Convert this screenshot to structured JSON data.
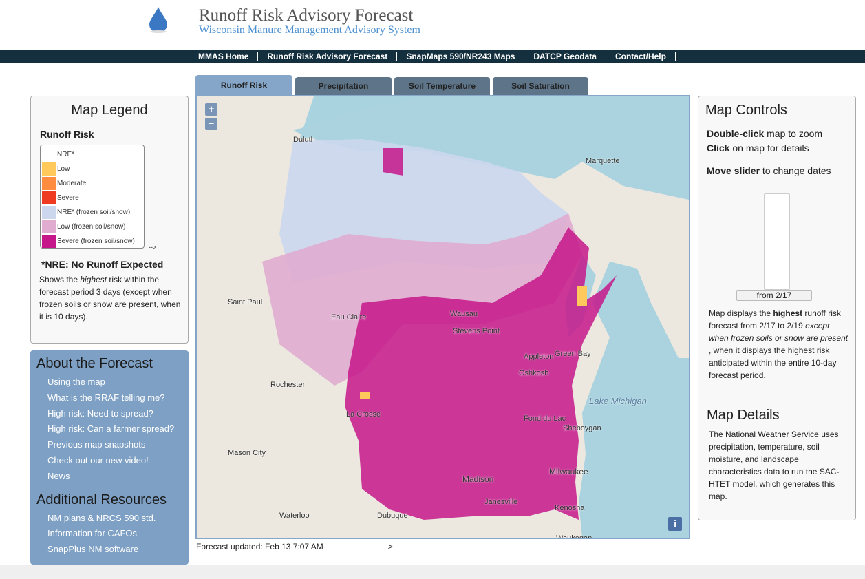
{
  "header": {
    "title": "Runoff Risk Advisory Forecast",
    "subtitle": "Wisconsin Manure Management Advisory System"
  },
  "nav": [
    "MMAS Home",
    "Runoff Risk Advisory Forecast",
    "SnapMaps 590/NR243 Maps",
    "DATCP Geodata",
    "Contact/Help"
  ],
  "legend": {
    "title": "Map Legend",
    "subtitle": "Runoff Risk",
    "items": [
      {
        "label": "NRE*",
        "color": "#ffffff"
      },
      {
        "label": "Low",
        "color": "#ffc95c"
      },
      {
        "label": "Moderate",
        "color": "#ff8c3f"
      },
      {
        "label": "Severe",
        "color": "#ee3b22"
      },
      {
        "label": "NRE* (frozen soil/snow)",
        "color": "#ccd7ee"
      },
      {
        "label": "Low (frozen soil/snow)",
        "color": "#e0acd0"
      },
      {
        "label": "Severe (frozen soil/snow)",
        "color": "#c5168a"
      }
    ],
    "arrow": "-->",
    "nre_note": "*NRE: No Runoff Expected",
    "note_pre": "Shows the ",
    "note_em": "highest",
    "note_post": " risk within the forecast period 3 days (except when frozen soils or snow are present, when it is 10 days)."
  },
  "about": {
    "title": "About the Forecast",
    "links": [
      "Using the map",
      "What is the RRAF telling me?",
      "High risk: Need to spread?",
      "High risk: Can a farmer spread?",
      "Previous map snapshots",
      "Check out our new video!",
      "News"
    ]
  },
  "resources": {
    "title": "Additional Resources",
    "links": [
      "NM plans & NRCS 590 std.",
      "Information for CAFOs",
      "SnapPlus NM software"
    ]
  },
  "tabs": [
    {
      "label": "Runoff Risk",
      "active": true
    },
    {
      "label": "Precipitation"
    },
    {
      "label": "Soil Temperature"
    },
    {
      "label": "Soil Saturation"
    }
  ],
  "map": {
    "zoom_in": "+",
    "zoom_out": "−",
    "info": "i",
    "labels": [
      "Duluth",
      "Marquette",
      "Saint Paul",
      "Eau Claire",
      "Wausau",
      "Stevens Point",
      "Green Bay",
      "Rochester",
      "Appleton",
      "Oshkosh",
      "Lake Michigan",
      "La Crosse",
      "Fond du Lac",
      "Sheboygan",
      "Mason City",
      "Madison",
      "Milwaukee",
      "Waterloo",
      "Dubuque",
      "Janesville",
      "Kenosha",
      "Waukegan"
    ]
  },
  "updated": "Forecast updated: Feb 13 7:07 AM",
  "updated_arrow": ">",
  "controls": {
    "title": "Map Controls",
    "dbl_b": "Double-click",
    "dbl": " map to zoom",
    "click_b": "Click",
    "click": " on map for details",
    "move_b": "Move slider",
    "move": " to change  dates",
    "slider_label": "from 2/17",
    "desc_pre": "Map displays the ",
    "desc_b": "highest",
    "desc_mid": " runoff risk forecast from 2/17 to 2/19 ",
    "desc_em": "except when frozen soils or snow are present",
    "desc_post": " , when it displays the highest risk anticipated within the entire 10-day forecast period.",
    "details_title": "Map Details",
    "details": "The National Weather Service uses precipitation, temperature, soil moisture, and landscape characteristics data to run the SAC-HTET model, which generates this map."
  }
}
